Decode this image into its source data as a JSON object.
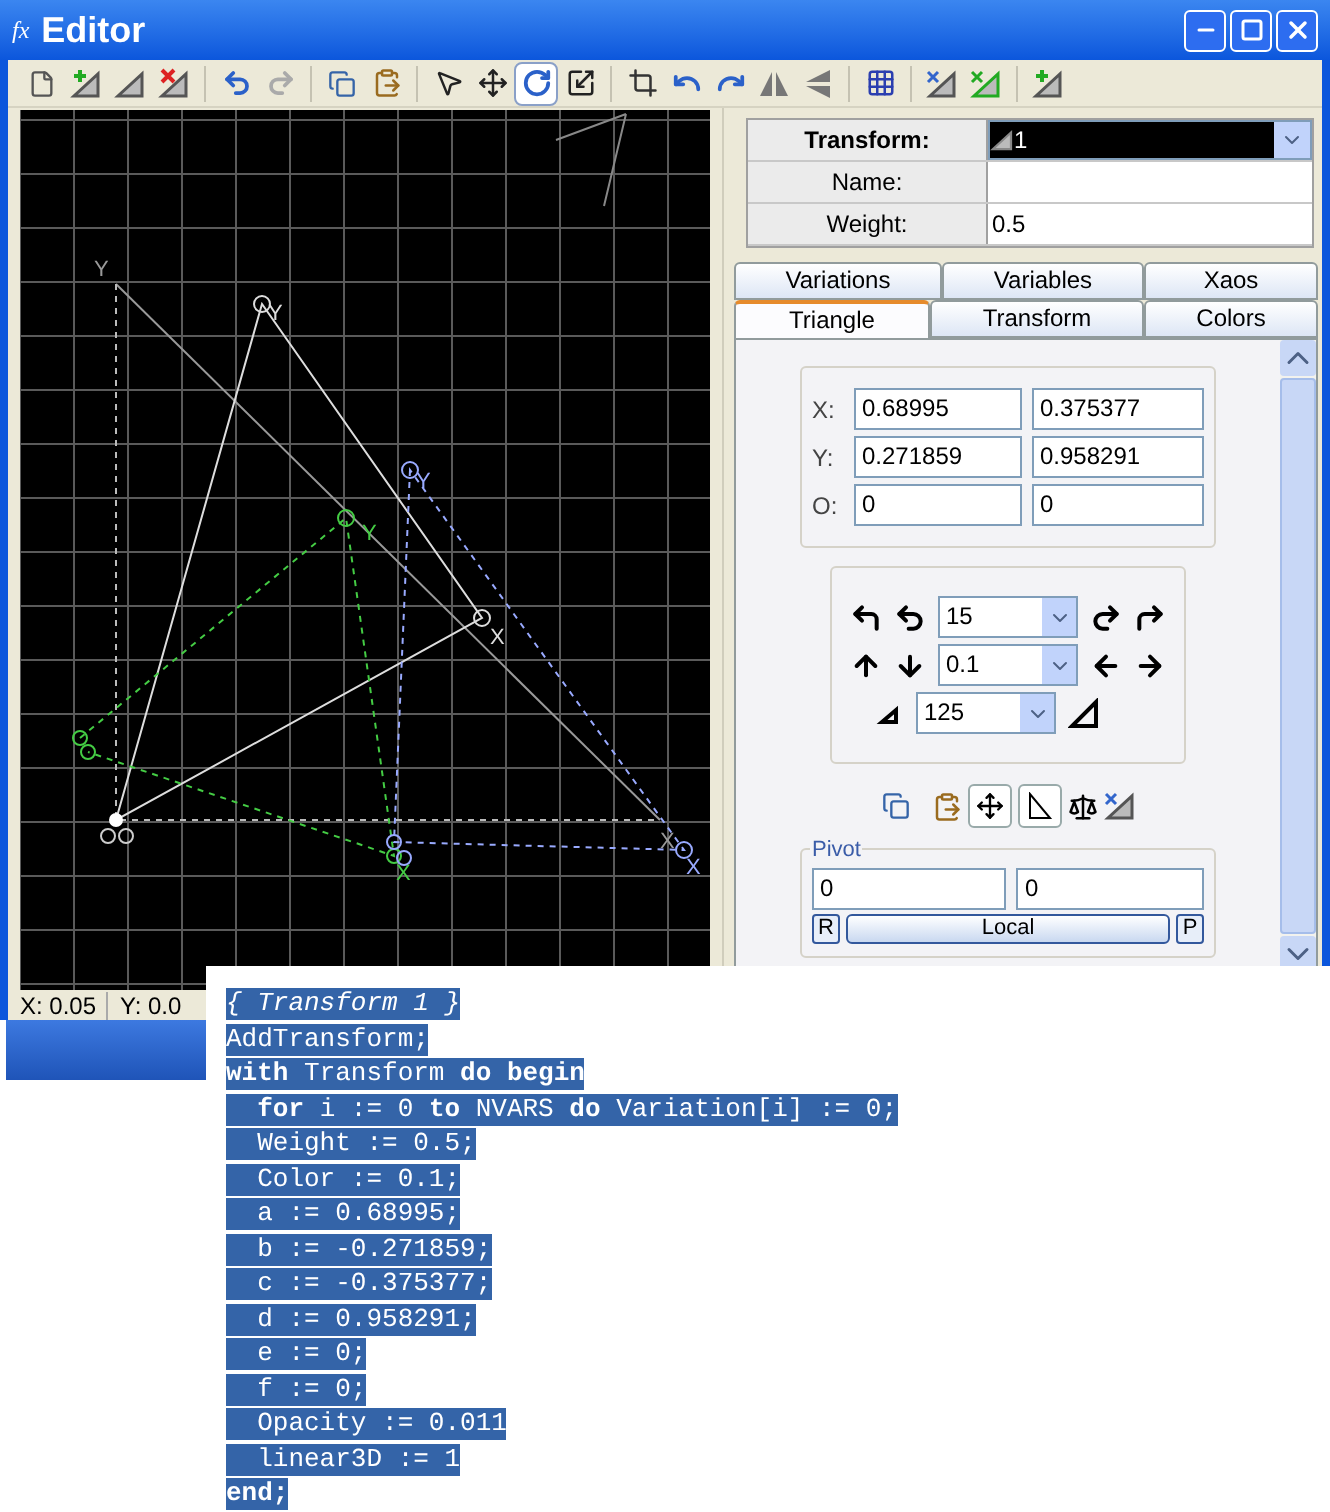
{
  "window": {
    "title": "Editor",
    "icon_label": "fx"
  },
  "toolbar": {
    "modes": [
      {
        "selected": false
      },
      {
        "selected": false
      },
      {
        "selected": true
      },
      {
        "selected": false
      }
    ],
    "redo": {
      "disabled": true
    }
  },
  "canvas": {
    "labels": [
      "Y",
      "X",
      "Y",
      "X",
      "Y",
      "X",
      "Y",
      "X"
    ]
  },
  "status_bar": [
    "X: 0.05",
    "Y: 0.0"
  ],
  "transform_table": {
    "rows": [
      {
        "label": "Transform:",
        "value": "1"
      },
      {
        "label": "Name:",
        "value": ""
      },
      {
        "label": "Weight:",
        "value": "0.5"
      }
    ]
  },
  "tabs": [
    {
      "label": "Variations",
      "selected": false
    },
    {
      "label": "Variables",
      "selected": false
    },
    {
      "label": "Xaos",
      "selected": false
    },
    {
      "label": "Triangle",
      "selected": true
    },
    {
      "label": "Transform",
      "selected": false
    },
    {
      "label": "Colors",
      "selected": false
    }
  ],
  "coordinates": [
    {
      "label": "X:",
      "values": [
        "0.68995",
        "0.375377"
      ]
    },
    {
      "label": "Y:",
      "values": [
        "0.271859",
        "0.958291"
      ]
    },
    {
      "label": "O:",
      "values": [
        "0",
        "0"
      ]
    }
  ],
  "adjust": {
    "rotate": "15",
    "move": "0.1",
    "scale": "125"
  },
  "toggles": [
    {
      "on": true
    },
    {
      "on": true
    }
  ],
  "pivot": {
    "title": "Pivot",
    "values": [
      "0",
      "0"
    ],
    "left_button": "R",
    "mode_button": "Local",
    "right_button": "P"
  },
  "script_lines": [
    {
      "text": "{ Transform 1 }",
      "kind": "comment"
    },
    {
      "text": "AddTransform;",
      "kind": "code"
    },
    {
      "text": "**with** Transform **do begin**",
      "kind": "code"
    },
    {
      "text": "  **for** i := 0 **to** NVARS **do** Variation[i] := 0;",
      "kind": "code"
    },
    {
      "text": "  Weight := 0.5;",
      "kind": "code"
    },
    {
      "text": "  Color := 0.1;",
      "kind": "code"
    },
    {
      "text": "  a := 0.68995;",
      "kind": "code"
    },
    {
      "text": "  b := -0.271859;",
      "kind": "code"
    },
    {
      "text": "  c := -0.375377;",
      "kind": "code"
    },
    {
      "text": "  d := 0.958291;",
      "kind": "code"
    },
    {
      "text": "  e := 0;",
      "kind": "code"
    },
    {
      "text": "  f := 0;",
      "kind": "code"
    },
    {
      "text": "  Opacity := 0.011",
      "kind": "code"
    },
    {
      "text": "  linear3D := 1",
      "kind": "code"
    },
    {
      "text": "**end;**",
      "kind": "code"
    }
  ]
}
